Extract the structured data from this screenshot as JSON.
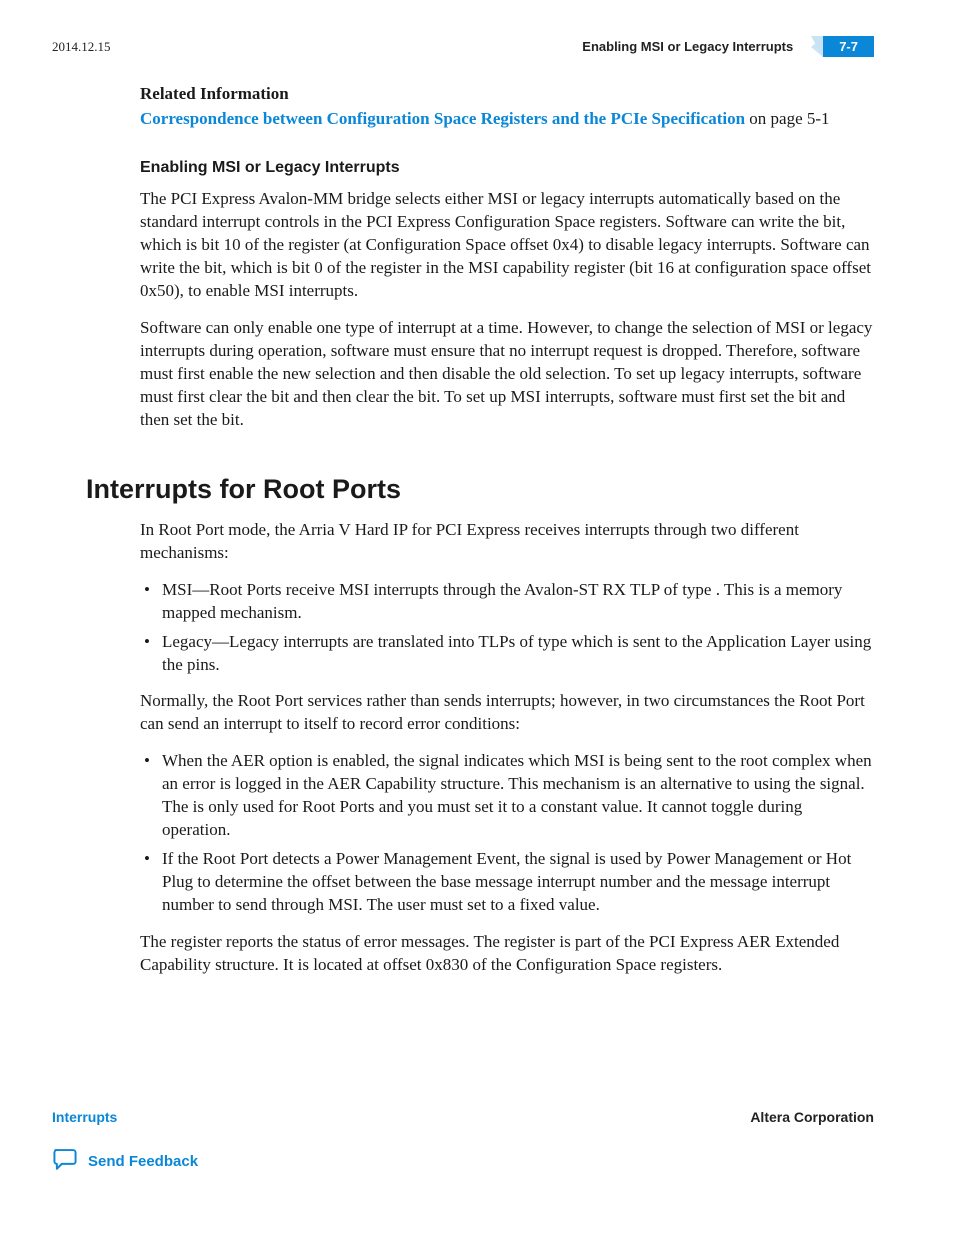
{
  "header": {
    "date": "2014.12.15",
    "running_title": "Enabling MSI or Legacy Interrupts",
    "page_num": "7-7"
  },
  "rel_info": {
    "label": "Related Information",
    "link_text": "Correspondence between Configuration Space Registers and the PCIe Specification",
    "link_suffix": " on page 5-1"
  },
  "sec1": {
    "title": "Enabling MSI or Legacy Interrupts",
    "p1": "The PCI Express Avalon-MM bridge selects either MSI or legacy interrupts automatically based on the standard interrupt controls in the PCI Express Configuration Space registers. Software can write the                                          bit, which is bit 10 of the                      register (at Configuration Space offset 0x4) to disable legacy interrupts. Software can write the                              bit, which is bit 0 of the                   register in the MSI capability register (bit 16 at configuration space offset 0x50), to enable MSI interrupts.",
    "p2": "Software can only enable one type of interrupt at a time. However, to change the selection of MSI or legacy interrupts during operation, software must ensure that no interrupt request is dropped. Therefore, software must first enable the new selection and then disable the old selection. To set up legacy interrupts, software must first clear the                                         bit and then clear the                              bit. To set up MSI interrupts, software must first set the                               bit and then set the                                          bit."
  },
  "sec2": {
    "title": "Interrupts for Root Ports",
    "intro": "In Root Port mode, the Arria V Hard IP for PCI Express receives interrupts through two different mechanisms:",
    "bullets1": [
      "MSI—Root Ports receive MSI interrupts through the Avalon-ST RX TLP of type       . This is a memory mapped mechanism.",
      "Legacy—Legacy interrupts are translated into TLPs of type                                         which is sent to the Application Layer using the                                       pins."
    ],
    "mid": "Normally, the Root Port services rather than sends interrupts; however, in two circumstances the Root Port can send an interrupt to itself to record error conditions:",
    "bullets2": [
      "When the AER option is enabled, the                                         signal indicates which MSI is being sent to the root complex when an error is logged in the AER Capability structure. This mechanism is an alternative to using the                       signal. The                                 is only used for Root Ports and you must set it to a constant value. It cannot toggle during operation.",
      "If the Root Port detects a Power Management Event, the                                        signal is used by Power Management or Hot Plug to determine the offset between the base message interrupt number and the message interrupt number to send through MSI. The user must set                                  to a fixed value."
    ],
    "p_end": "The                                      register reports the status of error messages. The                                    register is part of the PCI Express AER Extended Capability structure. It is located at offset 0x830 of the Configura­tion Space registers."
  },
  "footer": {
    "left": "Interrupts",
    "right": "Altera Corporation",
    "feedback": "Send Feedback"
  }
}
